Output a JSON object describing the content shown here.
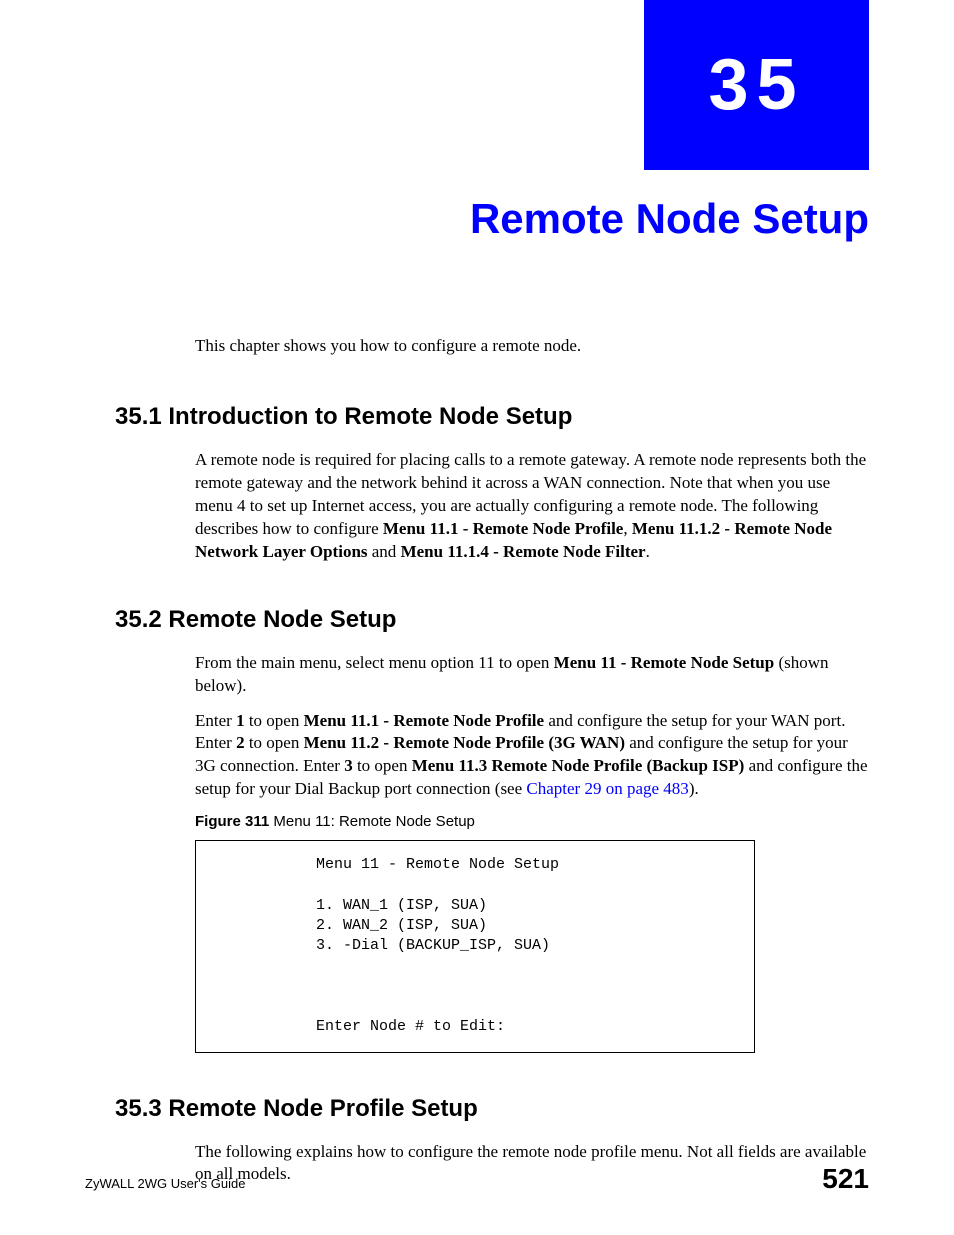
{
  "chapter": {
    "number": "35",
    "title": "Remote Node Setup"
  },
  "intro": "This chapter shows you how to configure a remote node.",
  "sections": {
    "s1": {
      "heading": "35.1  Introduction to Remote Node Setup",
      "p1_a": "A remote node is required for placing calls to a remote gateway. A remote node represents both the remote gateway and the network behind it across a WAN connection. Note that when you use menu 4 to set up Internet access, you are actually configuring a remote node. The following describes how to configure ",
      "p1_b1": "Menu 11.1 - Remote Node Profile",
      "p1_c": ", ",
      "p1_b2": "Menu 11.1.2 - Remote Node Network Layer Options",
      "p1_d": " and ",
      "p1_b3": "Menu 11.1.4 - Remote Node Filter",
      "p1_e": "."
    },
    "s2": {
      "heading": "35.2  Remote Node Setup",
      "p1_a": "From the main menu, select menu option 11 to open ",
      "p1_b1": "Menu 11 - Remote Node Setup",
      "p1_c": " (shown below).",
      "p2_a": "Enter ",
      "p2_b1": "1",
      "p2_c": " to open ",
      "p2_b2": "Menu 11.1 - Remote Node Profile",
      "p2_d": " and configure the setup for your WAN port. Enter ",
      "p2_b3": "2",
      "p2_e": " to open ",
      "p2_b4": "Menu 11.2 - Remote Node Profile (3G WAN)",
      "p2_f": " and configure the setup for your 3G connection. Enter ",
      "p2_b5": "3",
      "p2_g": " to open ",
      "p2_b6": "Menu 11.3 Remote Node Profile (Backup ISP)",
      "p2_h": " and configure the setup for your Dial Backup port connection (see ",
      "p2_link": "Chapter 29 on page 483",
      "p2_i": ").",
      "figure_label": "Figure 311   ",
      "figure_title": "Menu 11: Remote Node Setup",
      "menu_text": "Menu 11 - Remote Node Setup\n\n1. WAN_1 (ISP, SUA)\n2. WAN_2 (ISP, SUA)\n3. -Dial (BACKUP_ISP, SUA)\n\n\n\nEnter Node # to Edit:"
    },
    "s3": {
      "heading": "35.3  Remote Node Profile Setup",
      "p1": "The following explains how to configure the remote node profile menu. Not all fields are available on all models."
    }
  },
  "footer": {
    "left": "ZyWALL 2WG User's Guide",
    "right": "521"
  }
}
